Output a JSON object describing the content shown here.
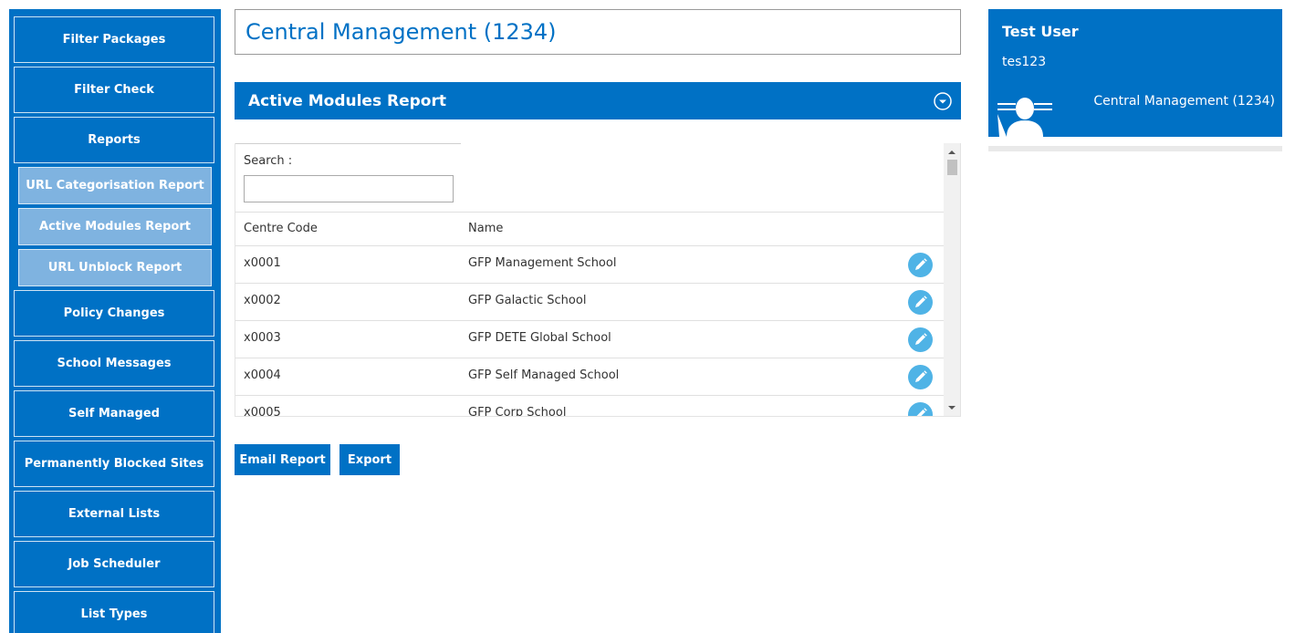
{
  "sidebar": {
    "items": [
      {
        "label": "Filter Packages"
      },
      {
        "label": "Filter Check"
      },
      {
        "label": "Reports"
      },
      {
        "label": "URL Categorisation Report"
      },
      {
        "label": "Active Modules Report"
      },
      {
        "label": "URL Unblock Report"
      },
      {
        "label": "Policy Changes"
      },
      {
        "label": "School Messages"
      },
      {
        "label": "Self Managed"
      },
      {
        "label": "Permanently Blocked Sites"
      },
      {
        "label": "External Lists"
      },
      {
        "label": "Job Scheduler"
      },
      {
        "label": "List Types"
      }
    ]
  },
  "page": {
    "title": "Central Management (1234)"
  },
  "panel": {
    "title": "Active Modules Report",
    "collapse_icon": "chevron-circle-down-icon"
  },
  "search": {
    "label": "Search :",
    "value": ""
  },
  "table": {
    "columns": [
      "Centre Code",
      "Name"
    ],
    "rows": [
      {
        "code": "x0001",
        "name": "GFP Management School"
      },
      {
        "code": "x0002",
        "name": "GFP Galactic School"
      },
      {
        "code": "x0003",
        "name": "GFP DETE Global School"
      },
      {
        "code": "x0004",
        "name": "GFP Self Managed School"
      },
      {
        "code": "x0005",
        "name": "GFP Corp School"
      }
    ],
    "row_action_icon": "pencil-icon"
  },
  "actions": {
    "email_label": "Email Report",
    "export_label": "Export"
  },
  "user": {
    "name": "Test User",
    "id": "tes123",
    "org": "Central Management (1234)",
    "avatar_icon": "user-silhouette-icon"
  },
  "colors": {
    "primary": "#0071c5",
    "sub_nav": "#7fb3e0",
    "edit_button": "#4fb3e6"
  }
}
